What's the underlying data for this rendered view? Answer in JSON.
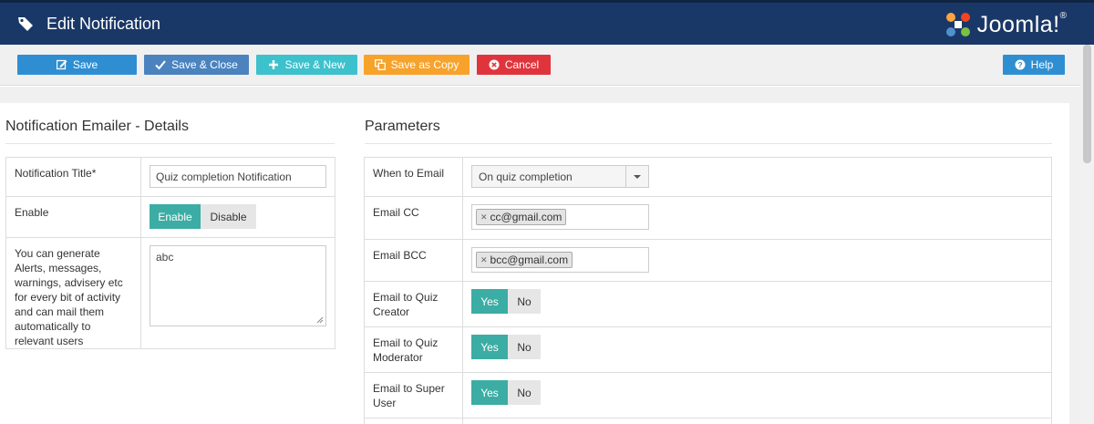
{
  "header": {
    "title": "Edit Notification",
    "logo_text": "Joomla!",
    "logo_reg": "®"
  },
  "toolbar": {
    "save": "Save",
    "save_close": "Save & Close",
    "save_new": "Save & New",
    "save_copy": "Save as Copy",
    "cancel": "Cancel",
    "help": "Help"
  },
  "details": {
    "title": "Notification Emailer - Details",
    "notification_title_label": "Notification Title*",
    "notification_title_value": "Quiz completion Notification",
    "enable_label": "Enable",
    "enable_on": "Enable",
    "enable_off": "Disable",
    "message_label": "You can generate Alerts, messages, warnings, advisery etc for every bit of activity and can mail them automatically to relevant users",
    "message_value": "abc"
  },
  "parameters": {
    "title": "Parameters",
    "when_label": "When to Email",
    "when_value": "On quiz completion",
    "cc_label": "Email CC",
    "cc_value": "cc@gmail.com",
    "bcc_label": "Email BCC",
    "bcc_value": "bcc@gmail.com",
    "creator_label": "Email to Quiz Creator",
    "moderator_label": "Email to Quiz Moderator",
    "super_label": "Email to Super User",
    "yes": "Yes",
    "no": "No"
  },
  "colors": {
    "header_bg": "#1a3867",
    "toggle_active": "#3bada4",
    "save": "#2f8ed2",
    "save_close": "#4b83bf",
    "save_new": "#3dc1cc",
    "save_copy": "#f7a32b",
    "cancel": "#e0343c"
  }
}
